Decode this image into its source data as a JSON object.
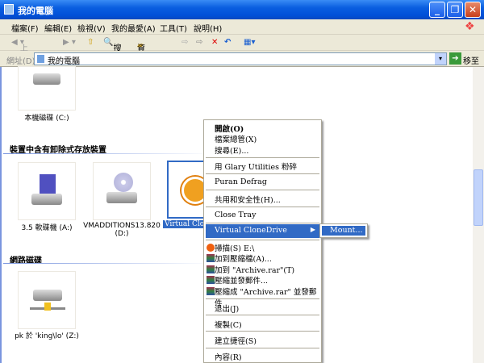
{
  "window": {
    "title": "我的電腦"
  },
  "menubar": [
    "檔案(F)",
    "編輯(E)",
    "檢視(V)",
    "我的最愛(A)",
    "工具(T)",
    "說明(H)"
  ],
  "toolbar": {
    "back": "上一頁",
    "search": "搜尋",
    "folders": "資料夾"
  },
  "address": {
    "label": "網址(D)",
    "value": "我的電腦",
    "go": "移至"
  },
  "groups": {
    "removable": "裝置中含有卸除式存放裝置",
    "network": "網路磁碟"
  },
  "drives": {
    "c": "本機磁碟 (C:)",
    "a": "3.5 軟碟機 (A:)",
    "d": "VMADDITIONS13.820 (D:)",
    "vcd": "Virtual Clone",
    "z": "pk 於 'king\\lo' (Z:)"
  },
  "context_menu": [
    "開啟(O)",
    "檔案總管(X)",
    "搜尋(E)...",
    "用 Glary Utilities 粉碎",
    "Puran Defrag",
    "共用和安全性(H)...",
    "Close Tray",
    "Virtual CloneDrive",
    "掃描(S) E:\\",
    "加到壓縮檔(A)...",
    "加到 \"Archive.rar\"(T)",
    "壓縮並發郵件...",
    "壓縮成 \"Archive.rar\" 並發郵件",
    "退出(J)",
    "複製(C)",
    "建立捷徑(S)",
    "內容(R)"
  ],
  "submenu": [
    "Mount..."
  ],
  "colors": {
    "titlebar": "#0a5ee0",
    "highlight": "#316ac5"
  }
}
